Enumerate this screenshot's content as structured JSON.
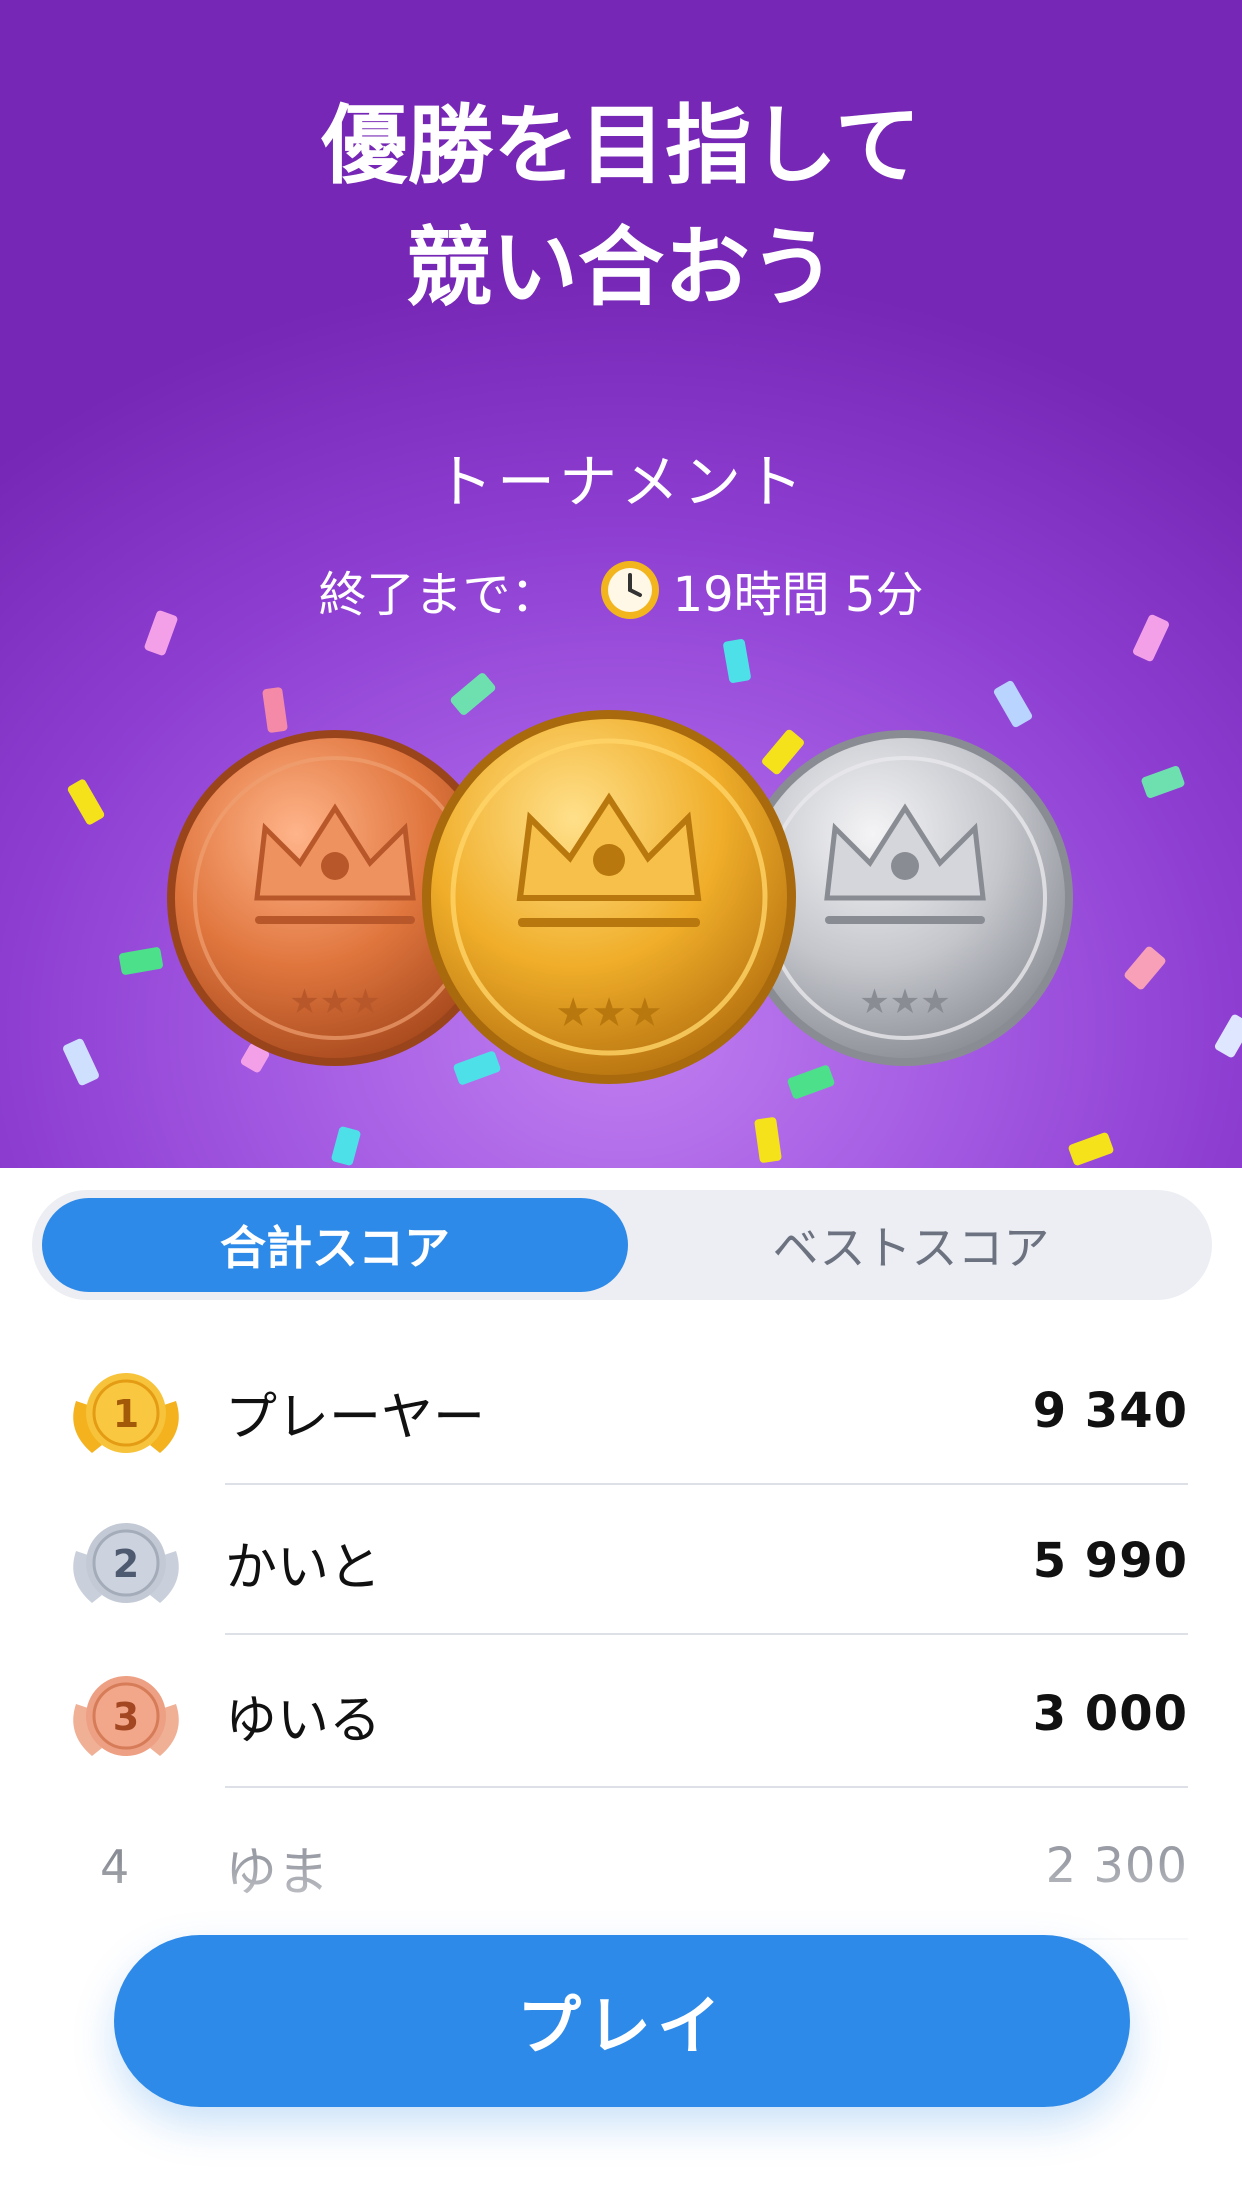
{
  "hero": {
    "headline_line1": "優勝を目指して",
    "headline_line2": "競い合おう",
    "subtitle": "トーナメント",
    "timer_label": "終了まで：",
    "timer_value": "19時間 5分",
    "timer_icon": "clock-icon",
    "medals": [
      "bronze-crown-medal",
      "gold-crown-medal",
      "silver-crown-medal"
    ]
  },
  "tabs": {
    "active": "合計スコア",
    "inactive": "ベストスコア"
  },
  "leaderboard": [
    {
      "rank": "1",
      "name": "プレーヤー",
      "score": "9 340",
      "badge": "gold-laurel-badge"
    },
    {
      "rank": "2",
      "name": "かいと",
      "score": "5 990",
      "badge": "silver-laurel-badge"
    },
    {
      "rank": "3",
      "name": "ゆいる",
      "score": "3 000",
      "badge": "bronze-laurel-badge"
    },
    {
      "rank": "4",
      "name": "ゆま",
      "score": "2 300"
    }
  ],
  "play_button": "プレイ",
  "colors": {
    "accent": "#2e8ae8",
    "hero_purple": "#8e3fd2",
    "gold": "#f5b21c",
    "silver": "#b8c0cc",
    "bronze": "#e8906a"
  }
}
